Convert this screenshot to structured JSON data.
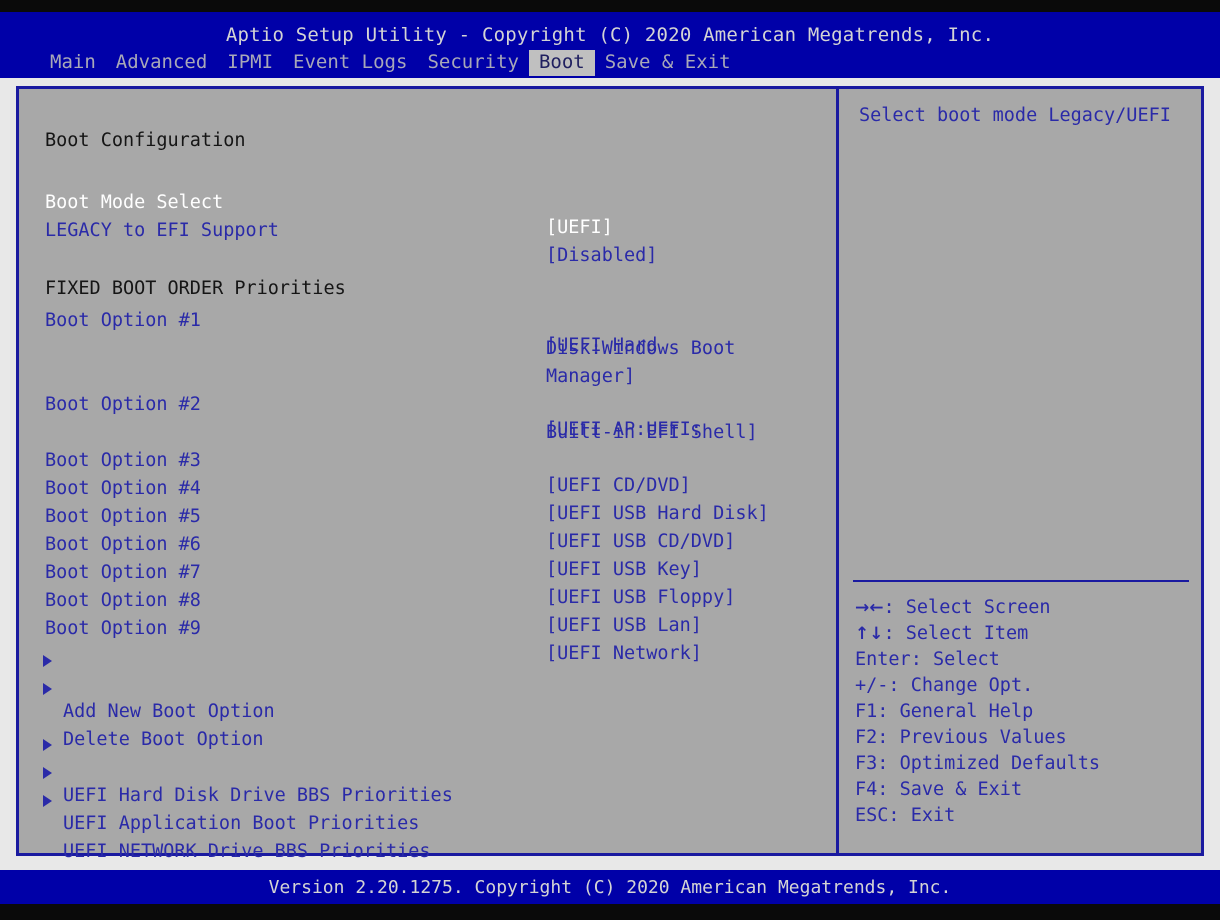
{
  "header": {
    "title": "Aptio Setup Utility - Copyright (C) 2020 American Megatrends, Inc.",
    "tabs": [
      {
        "label": "Main",
        "active": false
      },
      {
        "label": "Advanced",
        "active": false
      },
      {
        "label": "IPMI",
        "active": false
      },
      {
        "label": "Event Logs",
        "active": false
      },
      {
        "label": "Security",
        "active": false
      },
      {
        "label": "Boot",
        "active": true
      },
      {
        "label": "Save & Exit",
        "active": false
      }
    ]
  },
  "main": {
    "section_title": "Boot Configuration",
    "boot_mode_select": {
      "label": "Boot Mode Select",
      "value": "[UEFI]"
    },
    "legacy_to_efi": {
      "label": "LEGACY to EFI Support",
      "value": "[Disabled]"
    },
    "fixed_boot_order_title": "FIXED BOOT ORDER Priorities",
    "boot_options": [
      {
        "label": "Boot Option #1",
        "value": "[UEFI Hard Disk:Windows Boot Manager]"
      },
      {
        "label": "Boot Option #2",
        "value": "[UEFI AP:UEFI: Built-in EFI Shell]"
      },
      {
        "label": "Boot Option #3",
        "value": "[UEFI CD/DVD]"
      },
      {
        "label": "Boot Option #4",
        "value": "[UEFI USB Hard Disk]"
      },
      {
        "label": "Boot Option #5",
        "value": "[UEFI USB CD/DVD]"
      },
      {
        "label": "Boot Option #6",
        "value": "[UEFI USB Key]"
      },
      {
        "label": "Boot Option #7",
        "value": "[UEFI USB Floppy]"
      },
      {
        "label": "Boot Option #8",
        "value": "[UEFI USB Lan]"
      },
      {
        "label": "Boot Option #9",
        "value": "[UEFI Network]"
      }
    ],
    "option1_wrapped": [
      "[UEFI Hard",
      "Disk:Windows Boot",
      "Manager]"
    ],
    "option2_wrapped": [
      "[UEFI AP:UEFI:",
      "Built-in EFI Shell]"
    ],
    "submenus_group1": [
      {
        "label": "Add New Boot Option"
      },
      {
        "label": "Delete Boot Option"
      }
    ],
    "submenus_group2": [
      {
        "label": "UEFI Hard Disk Drive BBS Priorities"
      },
      {
        "label": "UEFI Application Boot Priorities"
      },
      {
        "label": "UEFI NETWORK Drive BBS Priorities"
      }
    ]
  },
  "help": {
    "description": "Select boot mode Legacy/UEFI",
    "legend": [
      {
        "key": "→←",
        "sep": ": ",
        "action": "Select Screen",
        "glyph": true
      },
      {
        "key": "↑↓",
        "sep": ": ",
        "action": "Select Item",
        "glyph": true
      },
      {
        "key": "Enter",
        "sep": ": ",
        "action": "Select",
        "glyph": false
      },
      {
        "key": "+/-",
        "sep": ": ",
        "action": "Change Opt.",
        "glyph": false
      },
      {
        "key": "F1",
        "sep": ": ",
        "action": "General Help",
        "glyph": false
      },
      {
        "key": "F2",
        "sep": ": ",
        "action": "Previous Values",
        "glyph": false
      },
      {
        "key": "F3",
        "sep": ": ",
        "action": "Optimized Defaults",
        "glyph": false
      },
      {
        "key": "F4",
        "sep": ": ",
        "action": "Save & Exit",
        "glyph": false
      },
      {
        "key": "ESC",
        "sep": ": ",
        "action": "Exit",
        "glyph": false
      }
    ]
  },
  "footer": {
    "version": "Version 2.20.1275. Copyright (C) 2020 American Megatrends, Inc."
  },
  "colors": {
    "header_blue": "#0000a8",
    "panel_gray": "#a8a8a8",
    "text_blue": "#2a2aa8",
    "selected_white": "#ffffff",
    "heading_black": "#151515",
    "border_blue": "#1a1aa0",
    "tab_active_bg": "#c0c0c0"
  }
}
